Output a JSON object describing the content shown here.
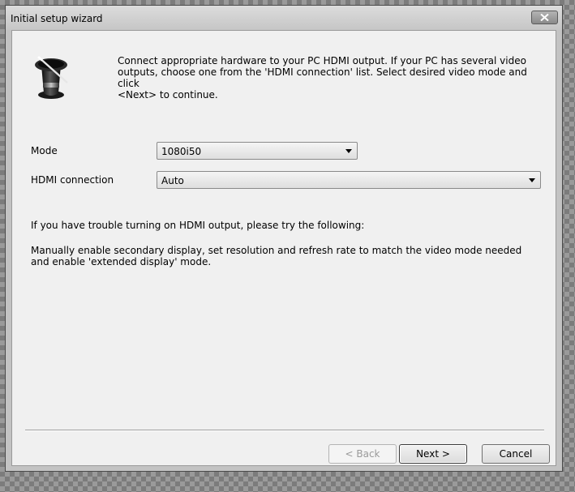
{
  "window": {
    "title": "Initial setup wizard",
    "close_icon": "close-x-icon",
    "wizard_icon": "top-hat-magic-wand-icon"
  },
  "intro": {
    "text": "Connect appropriate hardware to your PC HDMI output. If your PC has several video\noutputs, choose one from the 'HDMI connection' list. Select desired video mode and click\n<Next> to continue."
  },
  "mode": {
    "label": "Mode",
    "value": "1080i50"
  },
  "hdmi_connection": {
    "label": "HDMI connection",
    "value": "Auto"
  },
  "help": {
    "trouble_text": "If you have trouble turning on HDMI output, please try the following:",
    "instructions_text": "Manually enable secondary display, set resolution and refresh rate to match the video mode needed and enable 'extended display' mode."
  },
  "buttons": {
    "back_label": "< Back",
    "back_enabled": false,
    "next_label": "Next >",
    "cancel_label": "Cancel"
  }
}
